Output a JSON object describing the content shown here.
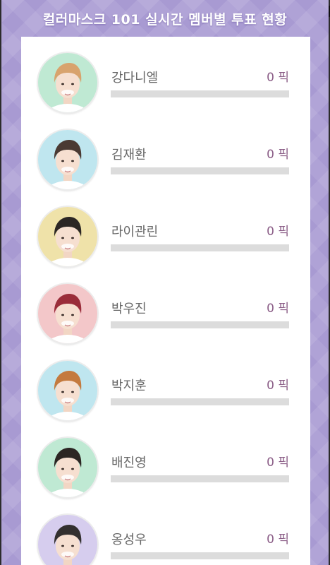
{
  "header": {
    "title": "컬러마스크 101 실시간 멤버별 투표 현황"
  },
  "members": [
    {
      "name": "강다니엘",
      "votes": "0 픽",
      "share": 0,
      "bg_color": "#bfe9d3",
      "hair_color": "#d8a36d",
      "avatar_icon": "member-photo"
    },
    {
      "name": "김재환",
      "votes": "0 픽",
      "share": 0,
      "bg_color": "#bfe6ef",
      "hair_color": "#4a3a33",
      "avatar_icon": "member-photo"
    },
    {
      "name": "라이관린",
      "votes": "0 픽",
      "share": 0,
      "bg_color": "#efe2a9",
      "hair_color": "#2b2624",
      "avatar_icon": "member-photo"
    },
    {
      "name": "박우진",
      "votes": "0 픽",
      "share": 0,
      "bg_color": "#f3c7c9",
      "hair_color": "#9a2d3a",
      "avatar_icon": "member-photo"
    },
    {
      "name": "박지훈",
      "votes": "0 픽",
      "share": 0,
      "bg_color": "#bfe6ef",
      "hair_color": "#c47a3e",
      "avatar_icon": "member-photo"
    },
    {
      "name": "배진영",
      "votes": "0 픽",
      "share": 0,
      "bg_color": "#bfe9d3",
      "hair_color": "#2c2623",
      "avatar_icon": "member-photo"
    },
    {
      "name": "옹성우",
      "votes": "0 픽",
      "share": 0,
      "bg_color": "#d6cdee",
      "hair_color": "#33302f",
      "avatar_icon": "member-photo"
    }
  ]
}
